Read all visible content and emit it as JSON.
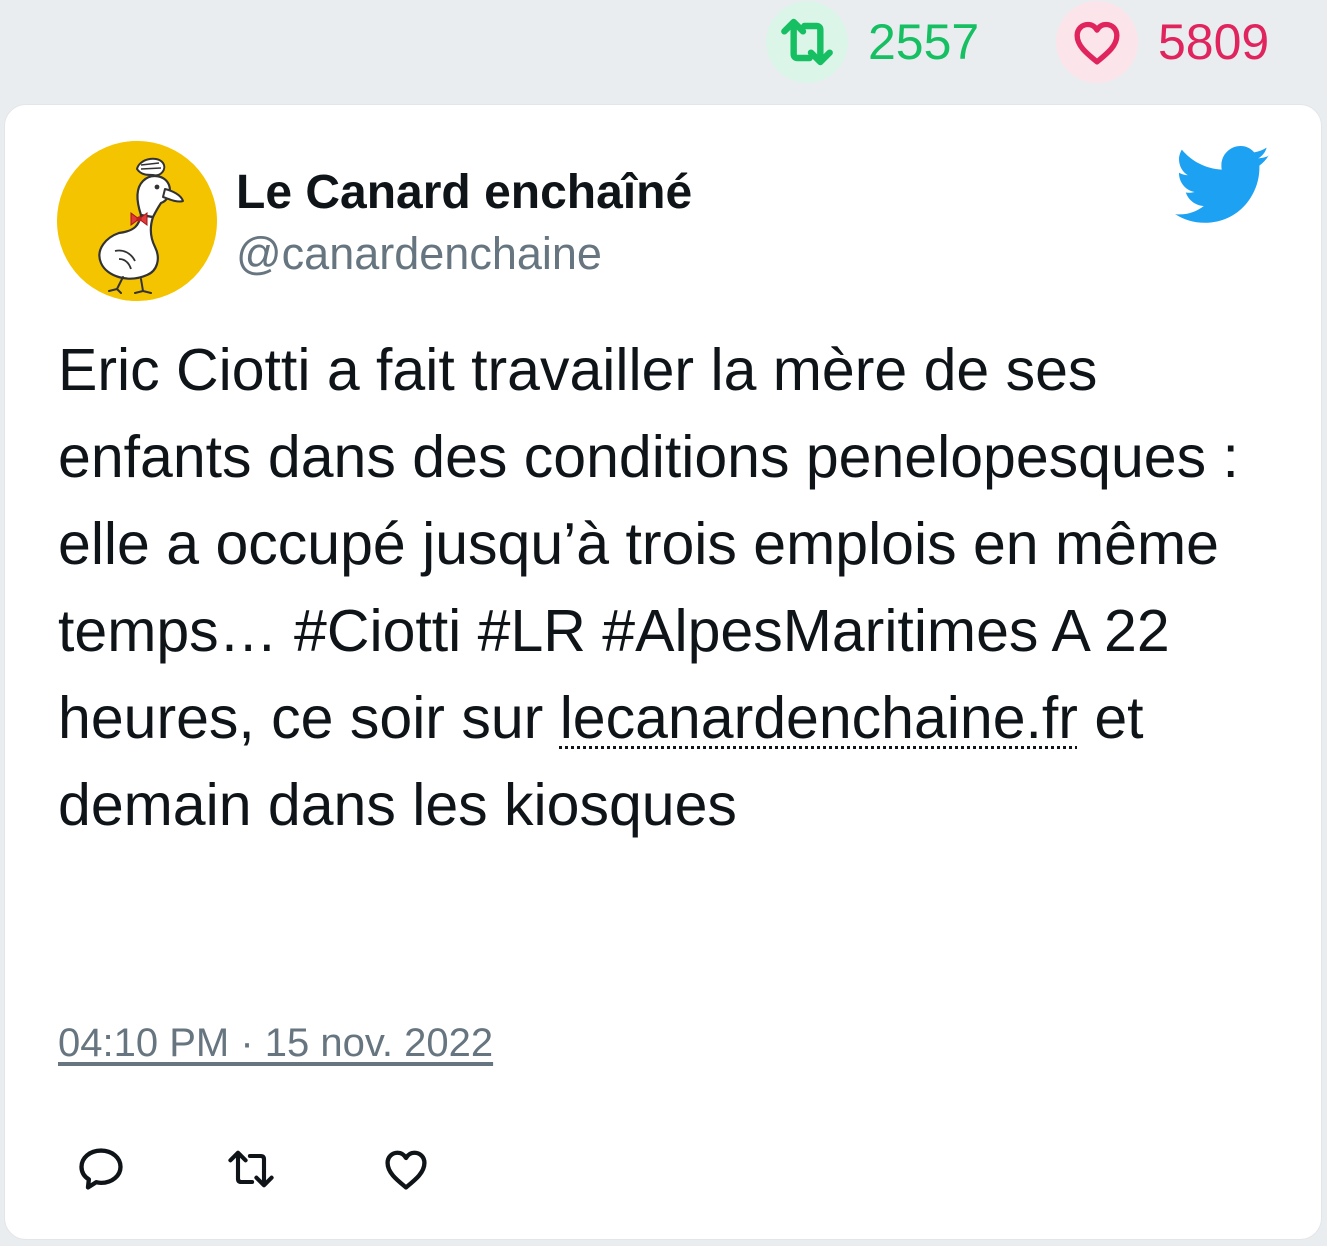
{
  "stats": {
    "retweet_count": "2557",
    "like_count": "5809",
    "retweet_icon": "retweet-icon",
    "like_icon": "heart-icon"
  },
  "tweet": {
    "author_name": "Le Canard enchaîné",
    "author_handle": "@canardenchaine",
    "avatar": "duck-logo",
    "platform_icon": "twitter-bird-icon",
    "text_before_link": "Eric Ciotti a fait travailler la mère de ses enfants dans des conditions penelopesques : elle a occupé jusqu’à trois emplois en même temps… #Ciotti #LR #AlpesMaritimes A 22 heures, ce soir sur ",
    "link_text": "lecanardenchaine.fr",
    "text_after_link": " et demain dans les kiosques",
    "timestamp": "04:10 PM · 15 nov. 2022"
  },
  "actions": [
    "reply-icon",
    "retweet-icon",
    "like-icon"
  ],
  "colors": {
    "retweet_green": "#17bf63",
    "like_red": "#e0245e",
    "twitter_blue": "#1da1f2",
    "handle_gray": "#66757f",
    "background": "#eaedf0"
  }
}
